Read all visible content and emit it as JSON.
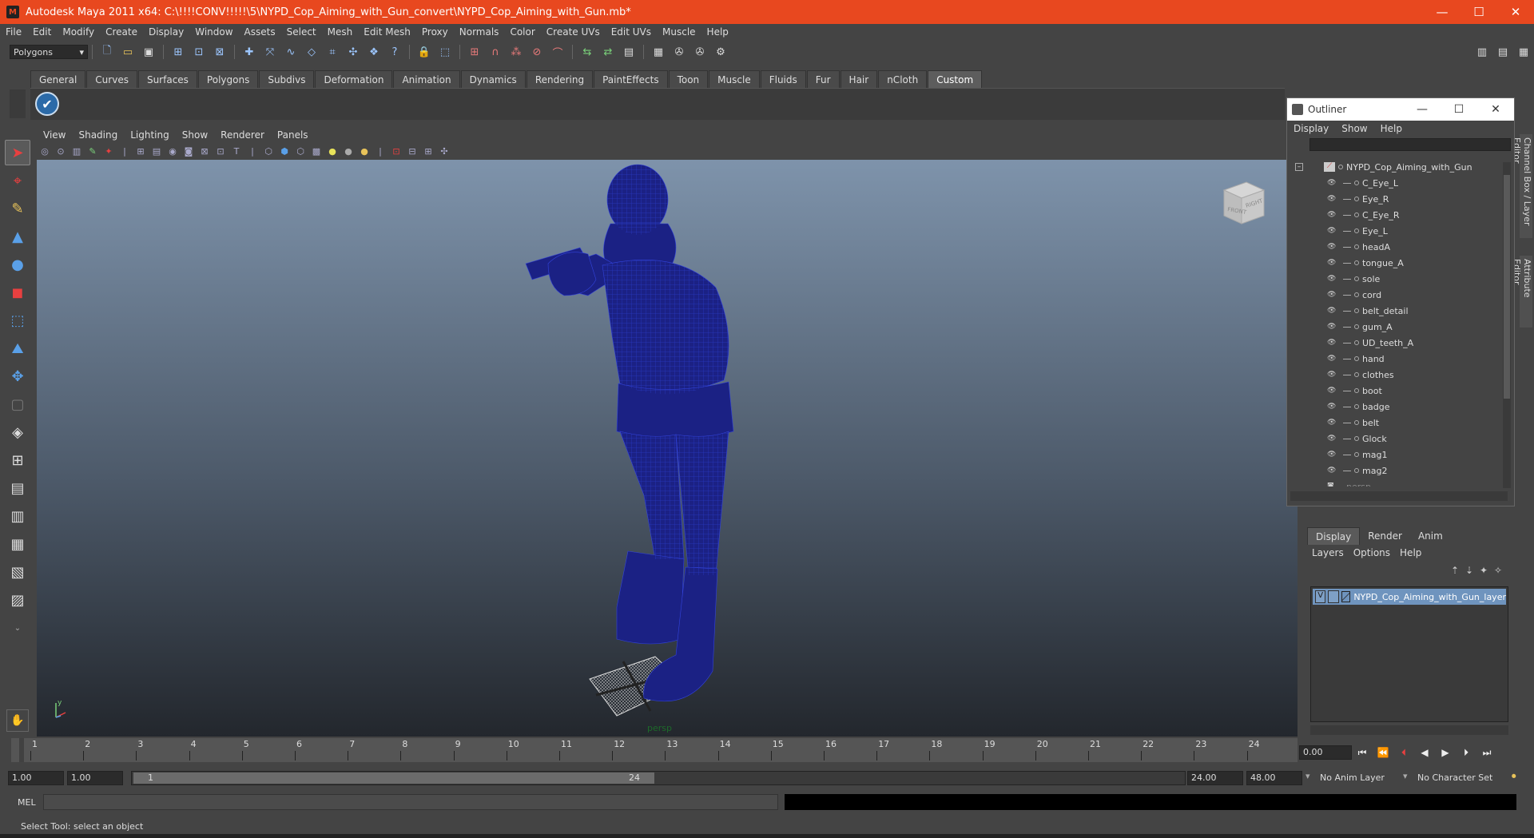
{
  "window": {
    "title": "Autodesk Maya 2011 x64: C:\\!!!!CONV!!!!!\\5\\NYPD_Cop_Aiming_with_Gun_convert\\NYPD_Cop_Aiming_with_Gun.mb*",
    "minimize": "—",
    "maximize": "☐",
    "close": "✕"
  },
  "menubar": [
    "File",
    "Edit",
    "Modify",
    "Create",
    "Display",
    "Window",
    "Assets",
    "Select",
    "Mesh",
    "Edit Mesh",
    "Proxy",
    "Normals",
    "Color",
    "Create UVs",
    "Edit UVs",
    "Muscle",
    "Help"
  ],
  "statusline": {
    "mode": "Polygons"
  },
  "shelf": {
    "tabs": [
      "General",
      "Curves",
      "Surfaces",
      "Polygons",
      "Subdivs",
      "Deformation",
      "Animation",
      "Dynamics",
      "Rendering",
      "PaintEffects",
      "Toon",
      "Muscle",
      "Fluids",
      "Fur",
      "Hair",
      "nCloth",
      "Custom"
    ],
    "active_tab": "Custom"
  },
  "viewport": {
    "menu": [
      "View",
      "Shading",
      "Lighting",
      "Show",
      "Renderer",
      "Panels"
    ],
    "camera_label": "persp",
    "viewcube_front": "FRONT",
    "viewcube_right": "RIGHT",
    "model_color": "#1b2184"
  },
  "outliner": {
    "title": "Outliner",
    "menu": [
      "Display",
      "Show",
      "Help"
    ],
    "root": "NYPD_Cop_Aiming_with_Gun",
    "children": [
      "C_Eye_L",
      "Eye_R",
      "C_Eye_R",
      "Eye_L",
      "headA",
      "tongue_A",
      "sole",
      "cord",
      "belt_detail",
      "gum_A",
      "UD_teeth_A",
      "hand",
      "clothes",
      "boot",
      "badge",
      "belt",
      "Glock",
      "mag1",
      "mag2"
    ],
    "camera": "persp"
  },
  "sidetabs": [
    "Channel Box / Layer Editor",
    "Attribute Editor"
  ],
  "layer_editor": {
    "tabs": [
      "Display",
      "Render",
      "Anim"
    ],
    "active_tab": "Display",
    "menu": [
      "Layers",
      "Options",
      "Help"
    ],
    "layer": {
      "visible": "V",
      "name": "NYPD_Cop_Aiming_with_Gun_layer",
      "color": "#6f94be"
    }
  },
  "timeslider": {
    "ticks": [
      1,
      2,
      3,
      4,
      5,
      6,
      7,
      8,
      9,
      10,
      11,
      12,
      13,
      14,
      15,
      16,
      17,
      18,
      19,
      20,
      21,
      22,
      23,
      24
    ],
    "current_time": "0.00"
  },
  "range": {
    "start_time": "1.00",
    "playback_start": "1.00",
    "slider_start": "1",
    "slider_end": "24",
    "playback_end": "24.00",
    "end_time": "48.00",
    "anim_layer": "No Anim Layer",
    "character_set": "No Character Set"
  },
  "cmdline": {
    "label": "MEL"
  },
  "helpline": {
    "text": "Select Tool: select an object"
  }
}
